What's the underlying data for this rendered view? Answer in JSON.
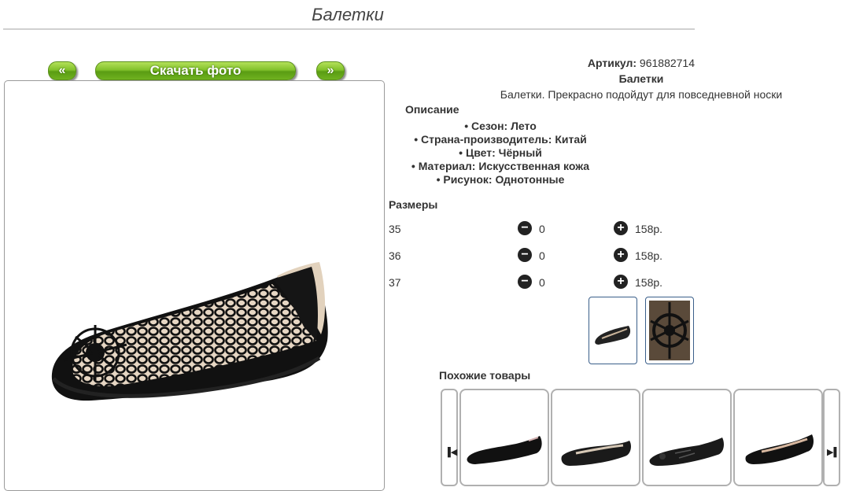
{
  "title": "Балетки",
  "buttons": {
    "prev": "«",
    "download": "Скачать фото",
    "next": "»"
  },
  "product": {
    "article_label": "Артикул:",
    "article_value": "961882714",
    "name": "Балетки",
    "short_description": "Балетки. Прекрасно подойдут для повседневной носки"
  },
  "description": {
    "heading": "Описание",
    "items": [
      "Сезон: Лето",
      "Страна-производитель: Китай",
      "Цвет: Чёрный",
      "Материал: Искусственная кожа",
      "Рисунок: Однотонные"
    ]
  },
  "sizes": {
    "heading": "Размеры",
    "rows": [
      {
        "size": "35",
        "qty": "0",
        "price": "158р."
      },
      {
        "size": "36",
        "qty": "0",
        "price": "158р."
      },
      {
        "size": "37",
        "qty": "0",
        "price": "158р."
      }
    ]
  },
  "similar": {
    "heading": "Похожие товары"
  },
  "icons": {
    "minus": "minus-circle-icon",
    "plus": "plus-circle-icon",
    "carousel_prev": "skip-previous-icon",
    "carousel_next": "skip-next-icon"
  },
  "colors": {
    "button_green": "#6fb21f",
    "thumb_border": "#3a5f8a"
  }
}
